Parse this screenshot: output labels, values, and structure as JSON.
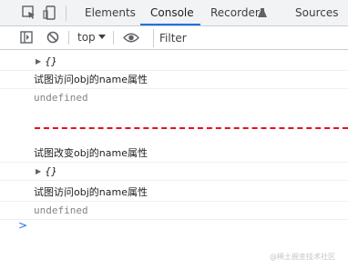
{
  "tabs": {
    "elements": "Elements",
    "console": "Console",
    "recorder": "Recorder",
    "sources": "Sources"
  },
  "toolbar": {
    "context": "top",
    "filter_placeholder": "Filter"
  },
  "console": {
    "rows": [
      {
        "type": "object",
        "text": "{}"
      },
      {
        "type": "log",
        "text": "试图访问obj的name属性"
      },
      {
        "type": "undefined",
        "text": "undefined"
      },
      {
        "type": "log",
        "text": "试图改变obj的name属性"
      },
      {
        "type": "object",
        "text": "{}"
      },
      {
        "type": "log",
        "text": "试图访问obj的name属性"
      },
      {
        "type": "undefined",
        "text": "undefined"
      }
    ],
    "prompt": ">"
  },
  "colors": {
    "accent": "#1a73e8",
    "divider_dash": "#e8101a"
  },
  "icons": [
    "inspect-icon",
    "device-toggle-icon",
    "sidebar-toggle-icon",
    "clear-console-icon",
    "dropdown-arrow-icon",
    "eye-icon",
    "recorder-flask-icon"
  ],
  "watermark": "@稀土掘金技术社区"
}
